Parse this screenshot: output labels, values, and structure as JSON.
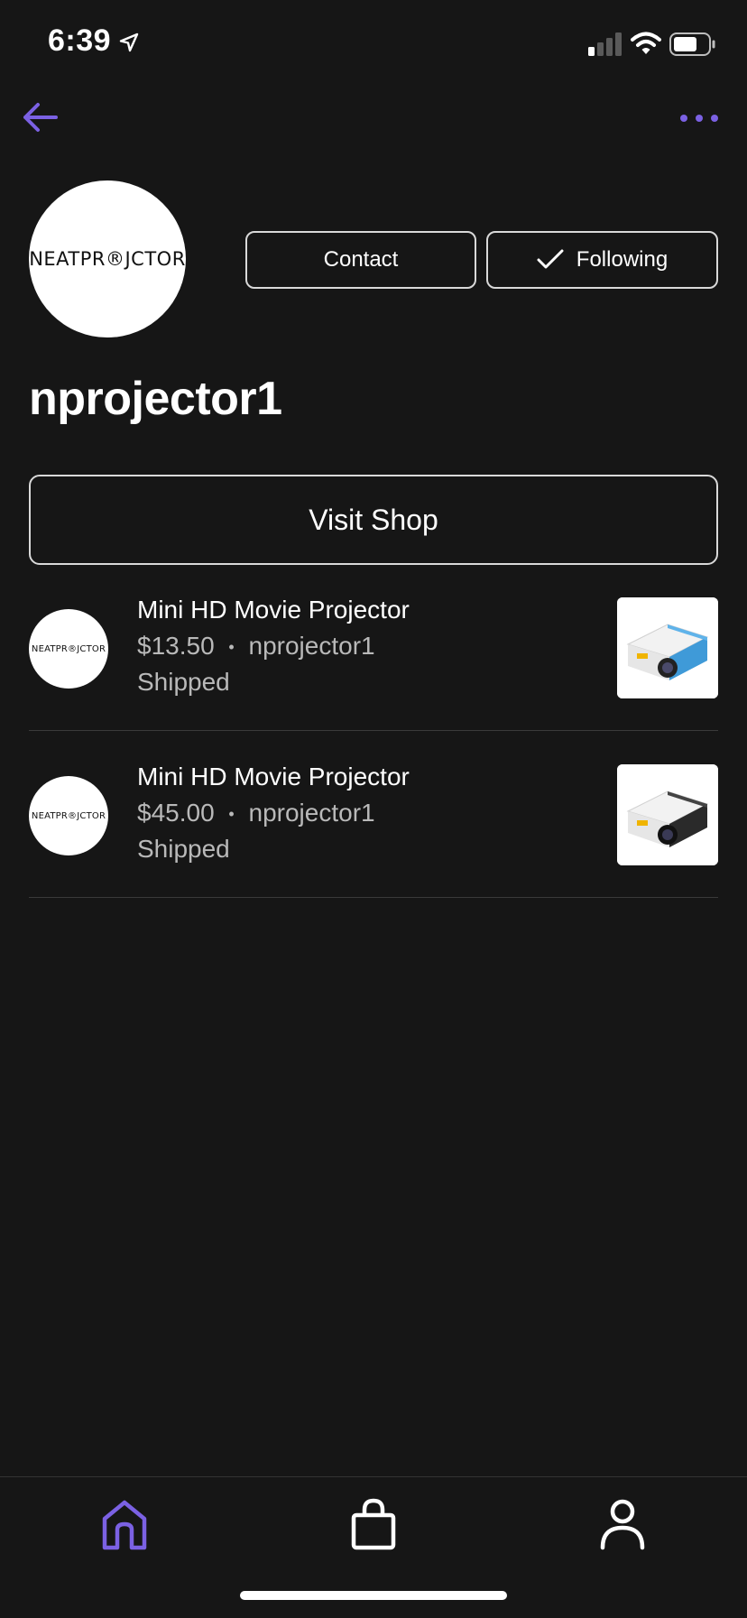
{
  "status_bar": {
    "time": "6:39"
  },
  "profile": {
    "logo_text": "NEATPR®JCTOR",
    "username": "nprojector1",
    "contact_label": "Contact",
    "following_label": "Following",
    "visit_shop_label": "Visit Shop"
  },
  "orders": [
    {
      "title": "Mini HD Movie Projector",
      "price": "$13.50",
      "separator": "•",
      "seller": "nprojector1",
      "status": "Shipped",
      "logo_text": "NEATPR®JCTOR",
      "product_color": "#3f9ad8"
    },
    {
      "title": "Mini HD Movie Projector",
      "price": "$45.00",
      "separator": "•",
      "seller": "nprojector1",
      "status": "Shipped",
      "logo_text": "NEATPR®JCTOR",
      "product_color": "#2a2a2a"
    }
  ],
  "colors": {
    "accent": "#7b61e3",
    "background": "#161616",
    "text_secondary": "#b9b9b9"
  },
  "icons": {
    "back": "arrow-left-icon",
    "more": "more-horizontal-icon",
    "home": "home-icon",
    "shop": "shopping-bag-icon",
    "profile": "user-icon",
    "following_check": "check-icon"
  }
}
